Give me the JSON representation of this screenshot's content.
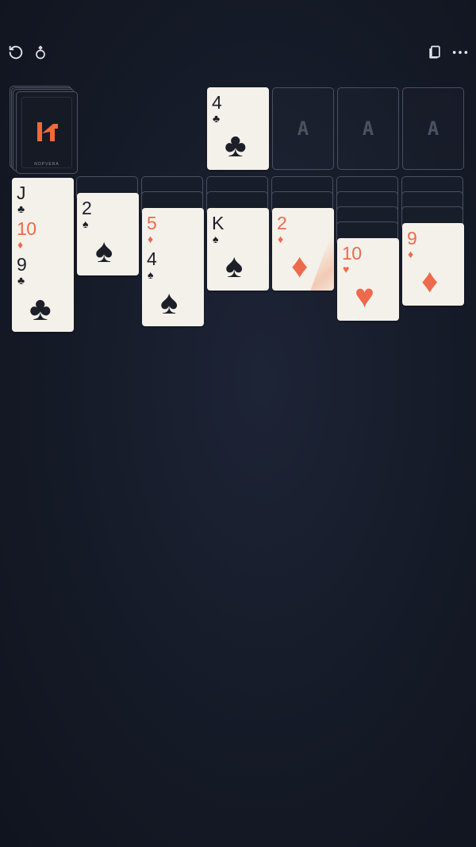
{
  "toolbar": {
    "undo_icon": "undo-icon",
    "hint_icon": "hint-icon",
    "cards_icon": "cards-icon",
    "more_icon": "more-icon"
  },
  "stock": {
    "brand": "NOPVERA"
  },
  "waste": {
    "rank": "4",
    "suit": "♣"
  },
  "foundations": [
    {
      "label": "A"
    },
    {
      "label": "A"
    },
    {
      "label": "A"
    }
  ],
  "tableau": [
    {
      "cards": [
        {
          "rank": "J",
          "suit": "♣"
        },
        {
          "rank": "10",
          "suit": "♦"
        },
        {
          "rank": "9",
          "suit": "♣"
        }
      ]
    },
    {
      "cards": [
        {
          "rank": "2",
          "suit": "♠"
        }
      ]
    },
    {
      "cards": [
        {
          "rank": "5",
          "suit": "♦"
        },
        {
          "rank": "4",
          "suit": "♠"
        }
      ]
    },
    {
      "cards": [
        {
          "rank": "K",
          "suit": "♠"
        }
      ]
    },
    {
      "cards": [
        {
          "rank": "2",
          "suit": "♦"
        }
      ]
    },
    {
      "cards": [
        {
          "rank": "10",
          "suit": "♥"
        }
      ]
    },
    {
      "cards": [
        {
          "rank": "9",
          "suit": "♦"
        }
      ]
    }
  ],
  "colors": {
    "red": "#ee6a4c",
    "black": "#1c1f27",
    "card": "#f4f1ea",
    "brand_orange": "#ee6a3a"
  }
}
